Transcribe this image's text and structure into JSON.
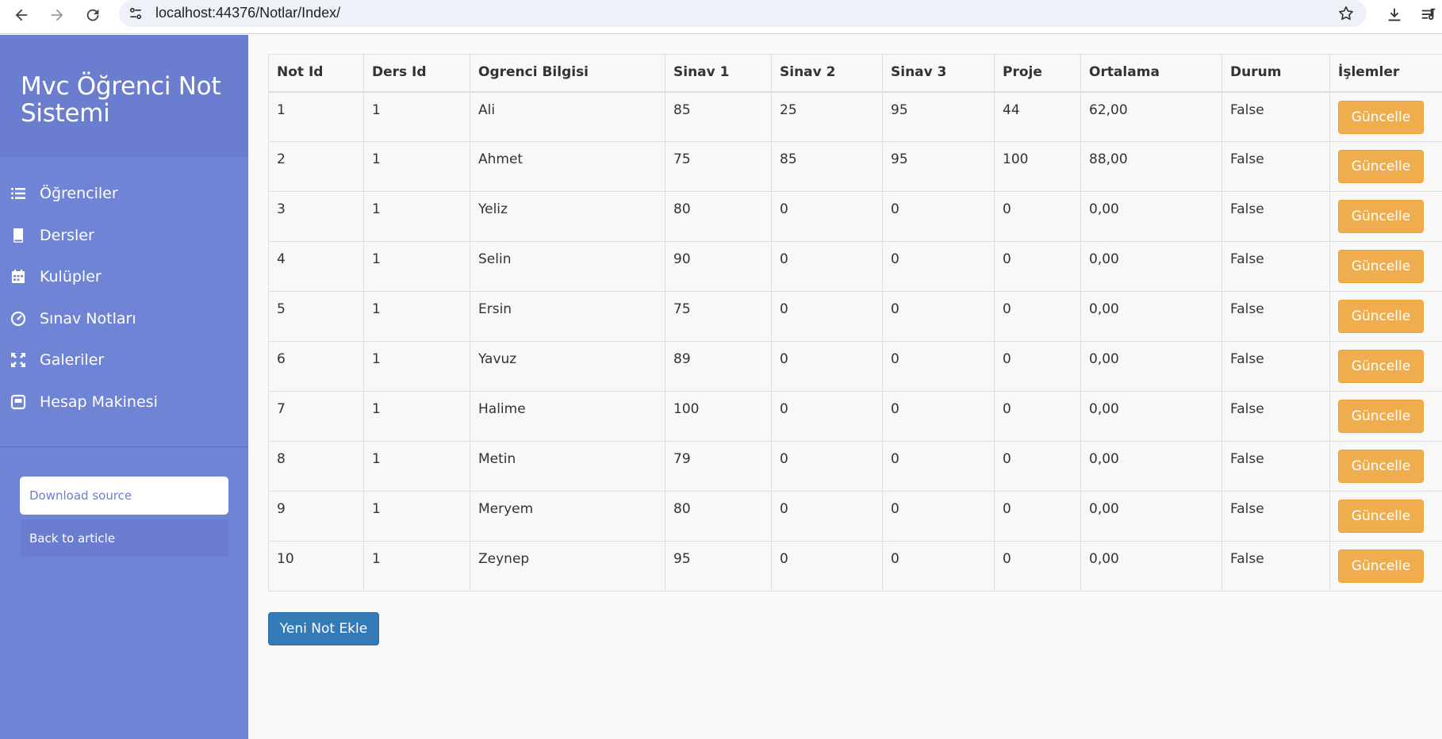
{
  "browser": {
    "url": "localhost:44376/Notlar/Index/"
  },
  "sidebar": {
    "title": "Mvc Öğrenci Not Sistemi",
    "items": [
      {
        "label": "Öğrenciler",
        "icon": "list-icon"
      },
      {
        "label": "Dersler",
        "icon": "book-icon"
      },
      {
        "label": "Kulüpler",
        "icon": "calendar-icon"
      },
      {
        "label": "Sınav Notları",
        "icon": "dashboard-icon"
      },
      {
        "label": "Galeriler",
        "icon": "fullscreen-icon"
      },
      {
        "label": "Hesap Makinesi",
        "icon": "calculator-icon"
      }
    ],
    "download_label": "Download source",
    "back_label": "Back to article"
  },
  "table": {
    "headers": [
      "Not Id",
      "Ders Id",
      "Ogrenci Bilgisi",
      "Sinav 1",
      "Sinav 2",
      "Sinav 3",
      "Proje",
      "Ortalama",
      "Durum",
      "İşlemler"
    ],
    "rows": [
      [
        "1",
        "1",
        "Ali",
        "85",
        "25",
        "95",
        "44",
        "62,00",
        "False"
      ],
      [
        "2",
        "1",
        "Ahmet",
        "75",
        "85",
        "95",
        "100",
        "88,00",
        "False"
      ],
      [
        "3",
        "1",
        "Yeliz",
        "80",
        "0",
        "0",
        "0",
        "0,00",
        "False"
      ],
      [
        "4",
        "1",
        "Selin",
        "90",
        "0",
        "0",
        "0",
        "0,00",
        "False"
      ],
      [
        "5",
        "1",
        "Ersin",
        "75",
        "0",
        "0",
        "0",
        "0,00",
        "False"
      ],
      [
        "6",
        "1",
        "Yavuz",
        "89",
        "0",
        "0",
        "0",
        "0,00",
        "False"
      ],
      [
        "7",
        "1",
        "Halime",
        "100",
        "0",
        "0",
        "0",
        "0,00",
        "False"
      ],
      [
        "8",
        "1",
        "Metin",
        "79",
        "0",
        "0",
        "0",
        "0,00",
        "False"
      ],
      [
        "9",
        "1",
        "Meryem",
        "80",
        "0",
        "0",
        "0",
        "0,00",
        "False"
      ],
      [
        "10",
        "1",
        "Zeynep",
        "95",
        "0",
        "0",
        "0",
        "0,00",
        "False"
      ]
    ],
    "row_button_label": "Güncelle"
  },
  "main": {
    "add_button_label": "Yeni Not Ekle"
  },
  "colors": {
    "sidebar": "#7084d6",
    "sidebar_header": "#6a7dce",
    "warning_button": "#f0ad4e",
    "primary_button": "#337ab7"
  }
}
